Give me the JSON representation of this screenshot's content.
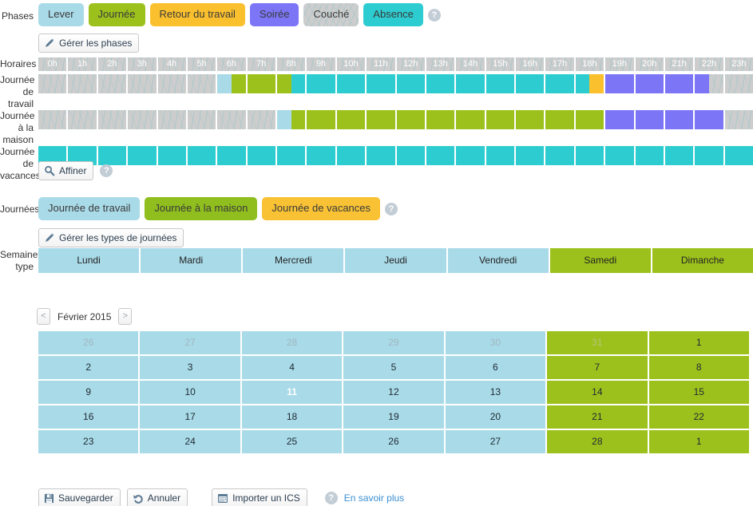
{
  "phases": {
    "label": "Phases",
    "items": [
      {
        "label": "Lever",
        "cls": "lever",
        "color": "#a9dae8"
      },
      {
        "label": "Journée",
        "cls": "journee",
        "color": "#9cc11c"
      },
      {
        "label": "Retour du travail",
        "cls": "retour",
        "color": "#fbc02d"
      },
      {
        "label": "Soirée",
        "cls": "soiree",
        "color": "#7c76f7"
      },
      {
        "label": "Couché",
        "cls": "couche",
        "color": "#cdcdcd"
      },
      {
        "label": "Absence",
        "cls": "absence",
        "color": "#2dccd0"
      }
    ],
    "help": "?",
    "manage_label": "Gérer les phases"
  },
  "schedule": {
    "label": "Horaires",
    "hours": [
      "0h",
      "1h",
      "2h",
      "3h",
      "4h",
      "5h",
      "6h",
      "7h",
      "8h",
      "9h",
      "10h",
      "11h",
      "12h",
      "13h",
      "14h",
      "15h",
      "16h",
      "17h",
      "18h",
      "19h",
      "20h",
      "21h",
      "22h",
      "23h"
    ],
    "rows": [
      {
        "label": "Journée de travail",
        "cells": [
          {
            "type": "tex"
          },
          {
            "type": "tex"
          },
          {
            "type": "tex"
          },
          {
            "type": "tex"
          },
          {
            "type": "tex"
          },
          {
            "type": "tex"
          },
          {
            "type": "split",
            "left": "c-lblue",
            "right": "c-green"
          },
          {
            "type": "solid",
            "color": "c-green"
          },
          {
            "type": "split",
            "left": "c-green",
            "right": "c-cyan"
          },
          {
            "type": "solid",
            "color": "c-cyan"
          },
          {
            "type": "solid",
            "color": "c-cyan"
          },
          {
            "type": "solid",
            "color": "c-cyan"
          },
          {
            "type": "solid",
            "color": "c-cyan"
          },
          {
            "type": "solid",
            "color": "c-cyan"
          },
          {
            "type": "solid",
            "color": "c-cyan"
          },
          {
            "type": "solid",
            "color": "c-cyan"
          },
          {
            "type": "solid",
            "color": "c-cyan"
          },
          {
            "type": "solid",
            "color": "c-cyan"
          },
          {
            "type": "split",
            "left": "c-cyan",
            "right": "c-orange"
          },
          {
            "type": "solid",
            "color": "c-purple"
          },
          {
            "type": "solid",
            "color": "c-purple"
          },
          {
            "type": "solid",
            "color": "c-purple"
          },
          {
            "type": "split",
            "left": "c-purple",
            "right": "tex"
          },
          {
            "type": "tex"
          }
        ]
      },
      {
        "label": "Journée à la maison",
        "cells": [
          {
            "type": "tex"
          },
          {
            "type": "tex"
          },
          {
            "type": "tex"
          },
          {
            "type": "tex"
          },
          {
            "type": "tex"
          },
          {
            "type": "tex"
          },
          {
            "type": "tex"
          },
          {
            "type": "tex"
          },
          {
            "type": "split",
            "left": "c-lblue",
            "right": "c-green"
          },
          {
            "type": "solid",
            "color": "c-green"
          },
          {
            "type": "solid",
            "color": "c-green"
          },
          {
            "type": "solid",
            "color": "c-green"
          },
          {
            "type": "solid",
            "color": "c-green"
          },
          {
            "type": "solid",
            "color": "c-green"
          },
          {
            "type": "solid",
            "color": "c-green"
          },
          {
            "type": "solid",
            "color": "c-green"
          },
          {
            "type": "solid",
            "color": "c-green"
          },
          {
            "type": "solid",
            "color": "c-green"
          },
          {
            "type": "solid",
            "color": "c-green"
          },
          {
            "type": "solid",
            "color": "c-purple"
          },
          {
            "type": "solid",
            "color": "c-purple"
          },
          {
            "type": "solid",
            "color": "c-purple"
          },
          {
            "type": "solid",
            "color": "c-purple"
          },
          {
            "type": "tex"
          }
        ]
      },
      {
        "label": "Journée de vacances",
        "cells": [
          {
            "type": "solid",
            "color": "c-cyan"
          },
          {
            "type": "solid",
            "color": "c-cyan"
          },
          {
            "type": "solid",
            "color": "c-cyan"
          },
          {
            "type": "solid",
            "color": "c-cyan"
          },
          {
            "type": "solid",
            "color": "c-cyan"
          },
          {
            "type": "solid",
            "color": "c-cyan"
          },
          {
            "type": "solid",
            "color": "c-cyan"
          },
          {
            "type": "solid",
            "color": "c-cyan"
          },
          {
            "type": "solid",
            "color": "c-cyan"
          },
          {
            "type": "solid",
            "color": "c-cyan"
          },
          {
            "type": "solid",
            "color": "c-cyan"
          },
          {
            "type": "solid",
            "color": "c-cyan"
          },
          {
            "type": "solid",
            "color": "c-cyan"
          },
          {
            "type": "solid",
            "color": "c-cyan"
          },
          {
            "type": "solid",
            "color": "c-cyan"
          },
          {
            "type": "solid",
            "color": "c-cyan"
          },
          {
            "type": "solid",
            "color": "c-cyan"
          },
          {
            "type": "solid",
            "color": "c-cyan"
          },
          {
            "type": "solid",
            "color": "c-cyan"
          },
          {
            "type": "solid",
            "color": "c-cyan"
          },
          {
            "type": "solid",
            "color": "c-cyan"
          },
          {
            "type": "solid",
            "color": "c-cyan"
          },
          {
            "type": "solid",
            "color": "c-cyan"
          },
          {
            "type": "solid",
            "color": "c-cyan"
          }
        ]
      }
    ],
    "refine_label": "Affiner",
    "refine_help": "?"
  },
  "daytypes": {
    "label": "Journées",
    "items": [
      {
        "label": "Journée de travail",
        "cls": "jtravail",
        "color": "#a9dae8"
      },
      {
        "label": "Journée à la maison",
        "cls": "jmaison",
        "color": "#8fbe1e"
      },
      {
        "label": "Journée de vacances",
        "cls": "jvacance",
        "color": "#f8c234"
      }
    ],
    "help": "?",
    "manage_label": "Gérer les types de journées"
  },
  "weektype": {
    "label": "Semaine type",
    "days": [
      {
        "name": "Lundi",
        "weekend": false
      },
      {
        "name": "Mardi",
        "weekend": false
      },
      {
        "name": "Mercredi",
        "weekend": false
      },
      {
        "name": "Jeudi",
        "weekend": false
      },
      {
        "name": "Vendredi",
        "weekend": false
      },
      {
        "name": "Samedi",
        "weekend": true
      },
      {
        "name": "Dimanche",
        "weekend": true
      }
    ]
  },
  "calendar": {
    "prev_label": "<",
    "next_label": ">",
    "month_label": "Février 2015",
    "weeks": [
      [
        {
          "d": "26",
          "weekend": false,
          "out": true,
          "today": false
        },
        {
          "d": "27",
          "weekend": false,
          "out": true,
          "today": false
        },
        {
          "d": "28",
          "weekend": false,
          "out": true,
          "today": false
        },
        {
          "d": "29",
          "weekend": false,
          "out": true,
          "today": false
        },
        {
          "d": "30",
          "weekend": false,
          "out": true,
          "today": false
        },
        {
          "d": "31",
          "weekend": true,
          "out": true,
          "today": false
        },
        {
          "d": "1",
          "weekend": true,
          "out": false,
          "today": false
        }
      ],
      [
        {
          "d": "2",
          "weekend": false,
          "out": false,
          "today": false
        },
        {
          "d": "3",
          "weekend": false,
          "out": false,
          "today": false
        },
        {
          "d": "4",
          "weekend": false,
          "out": false,
          "today": false
        },
        {
          "d": "5",
          "weekend": false,
          "out": false,
          "today": false
        },
        {
          "d": "6",
          "weekend": false,
          "out": false,
          "today": false
        },
        {
          "d": "7",
          "weekend": true,
          "out": false,
          "today": false
        },
        {
          "d": "8",
          "weekend": true,
          "out": false,
          "today": false
        }
      ],
      [
        {
          "d": "9",
          "weekend": false,
          "out": false,
          "today": false
        },
        {
          "d": "10",
          "weekend": false,
          "out": false,
          "today": false
        },
        {
          "d": "11",
          "weekend": false,
          "out": false,
          "today": true
        },
        {
          "d": "12",
          "weekend": false,
          "out": false,
          "today": false
        },
        {
          "d": "13",
          "weekend": false,
          "out": false,
          "today": false
        },
        {
          "d": "14",
          "weekend": true,
          "out": false,
          "today": false
        },
        {
          "d": "15",
          "weekend": true,
          "out": false,
          "today": false
        }
      ],
      [
        {
          "d": "16",
          "weekend": false,
          "out": false,
          "today": false
        },
        {
          "d": "17",
          "weekend": false,
          "out": false,
          "today": false
        },
        {
          "d": "18",
          "weekend": false,
          "out": false,
          "today": false
        },
        {
          "d": "19",
          "weekend": false,
          "out": false,
          "today": false
        },
        {
          "d": "20",
          "weekend": false,
          "out": false,
          "today": false
        },
        {
          "d": "21",
          "weekend": true,
          "out": false,
          "today": false
        },
        {
          "d": "22",
          "weekend": true,
          "out": false,
          "today": false
        }
      ],
      [
        {
          "d": "23",
          "weekend": false,
          "out": false,
          "today": false
        },
        {
          "d": "24",
          "weekend": false,
          "out": false,
          "today": false
        },
        {
          "d": "25",
          "weekend": false,
          "out": false,
          "today": false
        },
        {
          "d": "26",
          "weekend": false,
          "out": false,
          "today": false
        },
        {
          "d": "27",
          "weekend": false,
          "out": false,
          "today": false
        },
        {
          "d": "28",
          "weekend": true,
          "out": false,
          "today": false
        },
        {
          "d": "1",
          "weekend": true,
          "out": false,
          "today": false
        }
      ]
    ]
  },
  "footer": {
    "save_label": "Sauvegarder",
    "cancel_label": "Annuler",
    "import_label": "Importer un ICS",
    "help": "?",
    "learn_more_label": "En savoir plus"
  }
}
